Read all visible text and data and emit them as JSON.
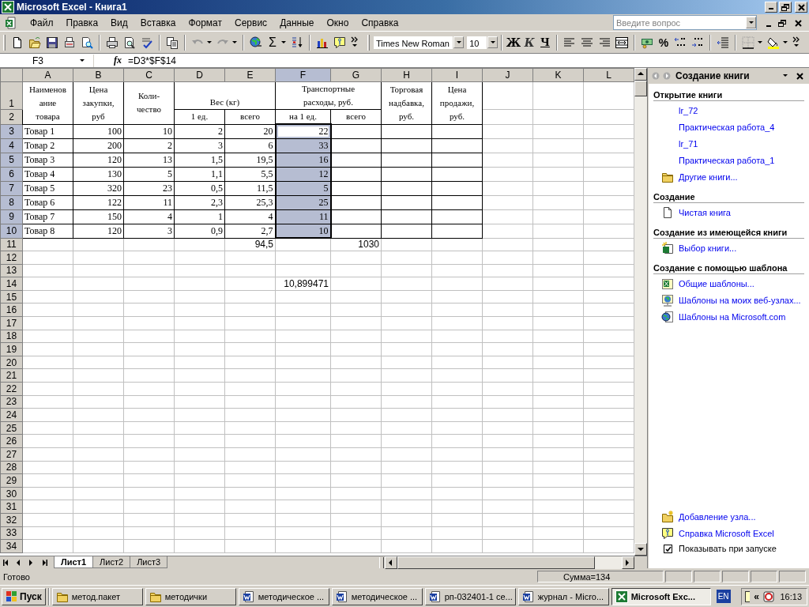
{
  "window": {
    "title": "Microsoft Excel - Книга1"
  },
  "menu": [
    {
      "label": "Файл"
    },
    {
      "label": "Правка"
    },
    {
      "label": "Вид"
    },
    {
      "label": "Вставка"
    },
    {
      "label": "Формат"
    },
    {
      "label": "Сервис"
    },
    {
      "label": "Данные"
    },
    {
      "label": "Окно"
    },
    {
      "label": "Справка"
    }
  ],
  "help_box": {
    "placeholder": "Введите вопрос"
  },
  "toolbar": {
    "sum": "Σ",
    "font": "Times New Roman",
    "size": "10",
    "bold": "Ж",
    "italic": "К",
    "underline": "Ч",
    "percent": "%"
  },
  "formula_bar": {
    "name_box": "F3",
    "fx": "fx",
    "formula": "=D3*$F$14"
  },
  "sheet": {
    "columns": [
      {
        "label": "A",
        "selected": false
      },
      {
        "label": "B",
        "selected": false
      },
      {
        "label": "C",
        "selected": false
      },
      {
        "label": "D",
        "selected": false
      },
      {
        "label": "E",
        "selected": false
      },
      {
        "label": "F",
        "selected": true
      },
      {
        "label": "G",
        "selected": false
      },
      {
        "label": "H",
        "selected": false
      },
      {
        "label": "I",
        "selected": false
      },
      {
        "label": "J",
        "selected": false
      },
      {
        "label": "K",
        "selected": false
      },
      {
        "label": "L",
        "selected": false
      }
    ],
    "header_rows": [
      {
        "number": "1",
        "selected": false,
        "cells": [
          {
            "kind": "merged_down",
            "lines": [
              "Наименов",
              "ание",
              "товара"
            ]
          },
          {
            "kind": "merged_down",
            "lines": [
              "Цена",
              "закупки,",
              "руб"
            ]
          },
          {
            "kind": "merged_down",
            "lines": [
              "Коли-",
              "чество"
            ]
          },
          {
            "kind": "merged_across",
            "lines": [
              "Вес (кг)"
            ]
          },
          {
            "kind": "merged_across",
            "lines": [
              "Транспортные",
              "расходы, руб."
            ]
          },
          {
            "kind": "merged_down",
            "lines": [
              "Торговая",
              "надбавка,",
              "руб."
            ]
          },
          {
            "kind": "merged_down",
            "lines": [
              "Цена",
              "продажи,",
              "руб."
            ]
          }
        ]
      },
      {
        "number": "2",
        "selected": false,
        "cells": [
          {
            "kind": "single",
            "lines": [
              "1 ед."
            ]
          },
          {
            "kind": "single",
            "lines": [
              "всего"
            ]
          },
          {
            "kind": "single",
            "lines": [
              "на 1 ед."
            ]
          },
          {
            "kind": "single",
            "lines": [
              "всего"
            ]
          }
        ]
      }
    ],
    "rows": [
      {
        "number": "3",
        "selected": true,
        "kind": "table",
        "cells": [
          {
            "text": "Товар 1",
            "selected": false
          },
          {
            "text": "100",
            "selected": false
          },
          {
            "text": "10",
            "selected": false
          },
          {
            "text": "2",
            "selected": false
          },
          {
            "text": "20",
            "selected": false
          },
          {
            "text": "22",
            "selected": true
          }
        ]
      },
      {
        "number": "4",
        "selected": true,
        "kind": "table",
        "cells": [
          {
            "text": "Товар 2",
            "selected": false
          },
          {
            "text": "200",
            "selected": false
          },
          {
            "text": "2",
            "selected": false
          },
          {
            "text": "3",
            "selected": false
          },
          {
            "text": "6",
            "selected": false
          },
          {
            "text": "33",
            "selected": true
          }
        ]
      },
      {
        "number": "5",
        "selected": true,
        "kind": "table",
        "cells": [
          {
            "text": "Товар 3",
            "selected": false
          },
          {
            "text": "120",
            "selected": false
          },
          {
            "text": "13",
            "selected": false
          },
          {
            "text": "1,5",
            "selected": false
          },
          {
            "text": "19,5",
            "selected": false
          },
          {
            "text": "16",
            "selected": true
          }
        ]
      },
      {
        "number": "6",
        "selected": true,
        "kind": "table",
        "cells": [
          {
            "text": "Товар 4",
            "selected": false
          },
          {
            "text": "130",
            "selected": false
          },
          {
            "text": "5",
            "selected": false
          },
          {
            "text": "1,1",
            "selected": false
          },
          {
            "text": "5,5",
            "selected": false
          },
          {
            "text": "12",
            "selected": true
          }
        ]
      },
      {
        "number": "7",
        "selected": true,
        "kind": "table",
        "cells": [
          {
            "text": "Товар 5",
            "selected": false
          },
          {
            "text": "320",
            "selected": false
          },
          {
            "text": "23",
            "selected": false
          },
          {
            "text": "0,5",
            "selected": false
          },
          {
            "text": "11,5",
            "selected": false
          },
          {
            "text": "5",
            "selected": true
          }
        ]
      },
      {
        "number": "8",
        "selected": true,
        "kind": "table",
        "cells": [
          {
            "text": "Товар 6",
            "selected": false
          },
          {
            "text": "122",
            "selected": false
          },
          {
            "text": "11",
            "selected": false
          },
          {
            "text": "2,3",
            "selected": false
          },
          {
            "text": "25,3",
            "selected": false
          },
          {
            "text": "25",
            "selected": true
          }
        ]
      },
      {
        "number": "9",
        "selected": true,
        "kind": "table",
        "cells": [
          {
            "text": "Товар 7",
            "selected": false
          },
          {
            "text": "150",
            "selected": false
          },
          {
            "text": "4",
            "selected": false
          },
          {
            "text": "1",
            "selected": false
          },
          {
            "text": "4",
            "selected": false
          },
          {
            "text": "11",
            "selected": true
          }
        ]
      },
      {
        "number": "10",
        "selected": true,
        "kind": "table",
        "cells": [
          {
            "text": "Товар 8",
            "selected": false
          },
          {
            "text": "120",
            "selected": false
          },
          {
            "text": "3",
            "selected": false
          },
          {
            "text": "0,9",
            "selected": false
          },
          {
            "text": "2,7",
            "selected": false
          },
          {
            "text": "10",
            "selected": true
          }
        ]
      },
      {
        "number": "11",
        "selected": false,
        "kind": "plain",
        "cells": [
          {
            "text": "",
            "selected": false
          },
          {
            "text": "",
            "selected": false
          },
          {
            "text": "",
            "selected": false
          },
          {
            "text": "",
            "selected": false
          },
          {
            "text": "94,5",
            "selected": false
          },
          {
            "text": "",
            "selected": false
          },
          {
            "text": "1030",
            "selected": false
          }
        ]
      },
      {
        "number": "12",
        "selected": false,
        "kind": "plain",
        "cells": []
      },
      {
        "number": "13",
        "selected": false,
        "kind": "plain",
        "cells": []
      },
      {
        "number": "14",
        "selected": false,
        "kind": "plain",
        "cells": [
          {
            "text": "",
            "selected": false
          },
          {
            "text": "",
            "selected": false
          },
          {
            "text": "",
            "selected": false
          },
          {
            "text": "",
            "selected": false
          },
          {
            "text": "",
            "selected": false
          },
          {
            "text": "10,899471",
            "selected": false
          }
        ]
      },
      {
        "number": "15",
        "selected": false,
        "kind": "plain",
        "cells": []
      },
      {
        "number": "16",
        "selected": false,
        "kind": "plain",
        "cells": []
      },
      {
        "number": "17",
        "selected": false,
        "kind": "plain",
        "cells": []
      },
      {
        "number": "18",
        "selected": false,
        "kind": "plain",
        "cells": []
      },
      {
        "number": "19",
        "selected": false,
        "kind": "plain",
        "cells": []
      },
      {
        "number": "20",
        "selected": false,
        "kind": "plain",
        "cells": []
      },
      {
        "number": "21",
        "selected": false,
        "kind": "plain",
        "cells": []
      },
      {
        "number": "22",
        "selected": false,
        "kind": "plain",
        "cells": []
      },
      {
        "number": "23",
        "selected": false,
        "kind": "plain",
        "cells": []
      },
      {
        "number": "24",
        "selected": false,
        "kind": "plain",
        "cells": []
      },
      {
        "number": "25",
        "selected": false,
        "kind": "plain",
        "cells": []
      },
      {
        "number": "26",
        "selected": false,
        "kind": "plain",
        "cells": []
      },
      {
        "number": "27",
        "selected": false,
        "kind": "plain",
        "cells": []
      },
      {
        "number": "28",
        "selected": false,
        "kind": "plain",
        "cells": []
      },
      {
        "number": "29",
        "selected": false,
        "kind": "plain",
        "cells": []
      },
      {
        "number": "30",
        "selected": false,
        "kind": "plain",
        "cells": []
      },
      {
        "number": "31",
        "selected": false,
        "kind": "plain",
        "cells": []
      },
      {
        "number": "32",
        "selected": false,
        "kind": "plain",
        "cells": []
      },
      {
        "number": "33",
        "selected": false,
        "kind": "plain",
        "cells": []
      },
      {
        "number": "34",
        "selected": false,
        "kind": "plain",
        "cells": []
      }
    ],
    "tabs": [
      {
        "label": "Лист1",
        "selected": true
      },
      {
        "label": "Лист2",
        "selected": false
      },
      {
        "label": "Лист3",
        "selected": false
      }
    ]
  },
  "task_pane": {
    "title": "Создание книги",
    "sections": [
      {
        "title": "Открытие книги",
        "items": [
          {
            "label": "lr_72",
            "kind": "file"
          },
          {
            "label": "Практическая работа_4",
            "kind": "file"
          },
          {
            "label": "lr_71",
            "kind": "file"
          },
          {
            "label": "Практическая работа_1",
            "kind": "file"
          },
          {
            "label": "Другие книги...",
            "kind": "folder"
          }
        ]
      },
      {
        "title": "Создание",
        "items": [
          {
            "label": "Чистая книга",
            "kind": "blank"
          }
        ]
      },
      {
        "title": "Создание из имеющейся книги",
        "items": [
          {
            "label": "Выбор книги...",
            "kind": "existing"
          }
        ]
      },
      {
        "title": "Создание с помощью шаблона",
        "items": [
          {
            "label": "Общие шаблоны...",
            "kind": "template"
          },
          {
            "label": "Шаблоны на моих веб-узлах...",
            "kind": "web"
          },
          {
            "label": "Шаблоны на Microsoft.com",
            "kind": "globe"
          }
        ]
      }
    ],
    "footer": [
      {
        "label": "Добавление узла...",
        "kind": "add_site"
      },
      {
        "label": "Справка Microsoft Excel",
        "kind": "help"
      }
    ],
    "startup_checkbox": {
      "label": "Показывать при запуске",
      "checked": true
    }
  },
  "status_bar": {
    "message": "Готово",
    "sum": "Сумма=134"
  },
  "taskbar": {
    "start": "Пуск",
    "buttons": [
      {
        "label": "метод.пакет",
        "kind": "folder",
        "selected": false
      },
      {
        "label": "методички",
        "kind": "folder",
        "selected": false
      },
      {
        "label": "методическое ...",
        "kind": "word",
        "selected": false
      },
      {
        "label": "методическое ...",
        "kind": "word",
        "selected": false
      },
      {
        "label": "рп-032401-1 се...",
        "kind": "word",
        "selected": false
      },
      {
        "label": "журнал - Micro...",
        "kind": "word",
        "selected": false
      },
      {
        "label": "Microsoft Exc...",
        "kind": "excel",
        "selected": true
      }
    ],
    "language": "EN",
    "tray_arrow": "«",
    "clock": "16:13"
  }
}
